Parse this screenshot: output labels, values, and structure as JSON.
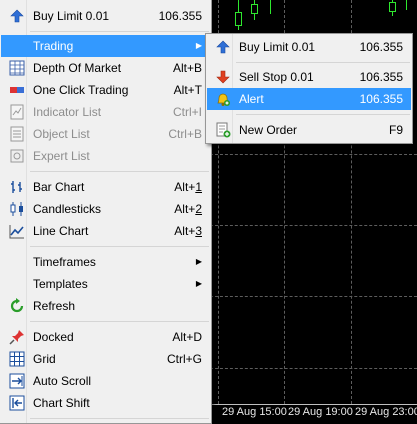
{
  "chart": {
    "time_labels": [
      "29 Aug 15:00",
      "29 Aug 19:00",
      "29 Aug 23:00"
    ]
  },
  "main_menu": {
    "buy_limit": {
      "label": "Buy Limit 0.01",
      "price": "106.355"
    },
    "trading": {
      "label": "Trading"
    },
    "depth_of_market": {
      "label": "Depth Of Market",
      "shortcut": "Alt+B"
    },
    "one_click_trading": {
      "label": "One Click Trading",
      "shortcut": "Alt+T"
    },
    "indicator_list": {
      "label": "Indicator List",
      "shortcut": "Ctrl+I"
    },
    "object_list": {
      "label": "Object List",
      "shortcut": "Ctrl+B"
    },
    "expert_list": {
      "label": "Expert List"
    },
    "bar_chart": {
      "label": "Bar Chart",
      "shortcut_prefix": "Alt+",
      "shortcut_key": "1"
    },
    "candlesticks": {
      "label": "Candlesticks",
      "shortcut_prefix": "Alt+",
      "shortcut_key": "2"
    },
    "line_chart": {
      "label": "Line Chart",
      "shortcut_prefix": "Alt+",
      "shortcut_key": "3"
    },
    "timeframes": {
      "label": "Timeframes"
    },
    "templates": {
      "label": "Templates"
    },
    "refresh": {
      "label": "Refresh"
    },
    "docked": {
      "label": "Docked",
      "shortcut": "Alt+D"
    },
    "grid": {
      "label": "Grid",
      "shortcut": "Ctrl+G"
    },
    "auto_scroll": {
      "label": "Auto Scroll"
    },
    "chart_shift": {
      "label": "Chart Shift"
    }
  },
  "trading_submenu": {
    "buy_limit": {
      "label": "Buy Limit 0.01",
      "price": "106.355"
    },
    "sell_stop": {
      "label": "Sell Stop 0.01",
      "price": "106.355"
    },
    "alert": {
      "label": "Alert",
      "price": "106.355"
    },
    "new_order": {
      "label": "New Order",
      "shortcut": "F9"
    }
  },
  "colors": {
    "highlight": "#3399ff",
    "menu_bg": "#f0f0f0",
    "chart_bg": "#000000",
    "candle": "#2ee82e"
  }
}
